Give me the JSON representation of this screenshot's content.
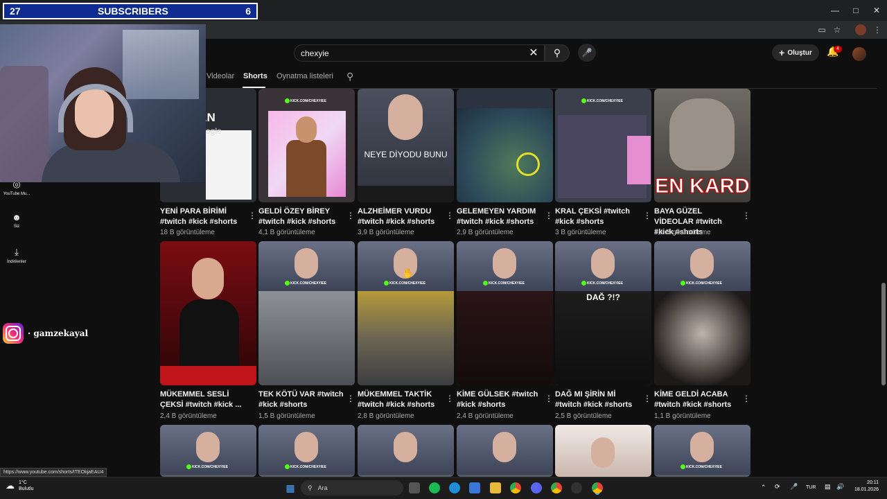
{
  "overlay": {
    "subs_left": "27",
    "subs_label": "SUBSCRIBERS",
    "subs_right": "6"
  },
  "search": {
    "query": "chexyie"
  },
  "header": {
    "create_label": "Oluştur",
    "notif_count": "4"
  },
  "tabs": [
    {
      "label": "Videolar"
    },
    {
      "label": "Shorts"
    },
    {
      "label": "Oynatma listeleri"
    }
  ],
  "sidebar": [
    {
      "label": "YouTube Mu..."
    },
    {
      "label": "Siz"
    },
    {
      "label": "İndirilenler"
    }
  ],
  "instagram": {
    "handle": "· gamzekayal"
  },
  "thumb_text": {
    "istan": "İSTAN",
    "ogle": "ogle",
    "neye": "NEYE DİYODU BUNU",
    "kard": "EN KARD",
    "dag": "DAĞ ?!?",
    "kick": "KICK.COM/CHEXYIEE"
  },
  "shorts_row1": [
    {
      "title": "YENİ PARA BİRİMİ #twitch #kick #shorts",
      "views": "18 B görüntüleme"
    },
    {
      "title": "GELDİ ÖZEY BİREY #twitch #kick #shorts",
      "views": "4,1 B görüntüleme"
    },
    {
      "title": "ALZHEİMER VURDU #twitch #kick #shorts",
      "views": "3,9 B görüntüleme"
    },
    {
      "title": "GELEMEYEN YARDIM #twitch #kick #shorts",
      "views": "2,9 B görüntüleme"
    },
    {
      "title": "KRAL ÇEKSİ #twitch #kick #shorts",
      "views": "3 B görüntüleme"
    },
    {
      "title": "BAYA GÜZEL VİDEOLAR #twitch #kick #shorts",
      "views": "3,1 B görüntüleme"
    }
  ],
  "shorts_row2": [
    {
      "title": "MÜKEMMEL SESLİ ÇEKSİ #twitch #kick ...",
      "views": "2,4 B görüntüleme"
    },
    {
      "title": "TEK KÖTÜ VAR #twitch #kick #shorts",
      "views": "1,5 B görüntüleme"
    },
    {
      "title": "MÜKEMMEL TAKTİK #twitch #kick #shorts",
      "views": "2,8 B görüntüleme"
    },
    {
      "title": "KİME GÜLSEK #twitch #kick #shorts",
      "views": "2,4 B görüntüleme"
    },
    {
      "title": "DAĞ MI ŞİRİN Mİ #twitch #kick #shorts",
      "views": "2,5 B görüntüleme"
    },
    {
      "title": "KİME GELDİ ACABA #twitch #kick #shorts",
      "views": "1,1 B görüntüleme"
    }
  ],
  "status_url": "https://www.youtube.com/shorts/tTEOkjaEAU4",
  "taskbar": {
    "weather_temp": "1°C",
    "weather_desc": "Bulutlu",
    "search_label": "Ara",
    "lang": "TUR",
    "time": "20:11",
    "date": "18.01.2026"
  }
}
